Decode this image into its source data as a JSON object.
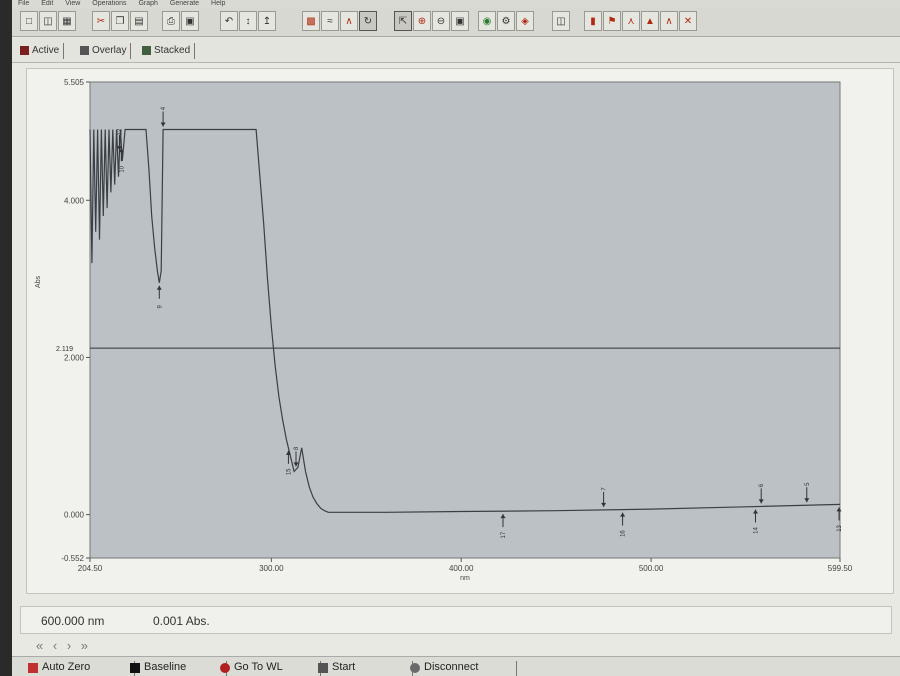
{
  "menu": [
    "File",
    "Edit",
    "View",
    "Operations",
    "Graph",
    "Generate",
    "Help"
  ],
  "tabs": [
    {
      "label": "Active"
    },
    {
      "label": "Overlay"
    },
    {
      "label": "Stacked"
    }
  ],
  "status": {
    "wavelength": "600.000 nm",
    "absorbance": "0.001 Abs."
  },
  "nav_arrows": [
    "«",
    "‹",
    "›",
    "»"
  ],
  "bottom_buttons": [
    {
      "label": "Auto Zero",
      "icon": "auto-zero-icon"
    },
    {
      "label": "Baseline",
      "icon": "baseline-icon"
    },
    {
      "label": "Go To WL",
      "icon": "goto-wl-icon"
    },
    {
      "label": "Start",
      "icon": "start-icon"
    },
    {
      "label": "Disconnect",
      "icon": "disconnect-icon"
    }
  ],
  "colors": {
    "plot_background": "#bcc1c6",
    "trace": "#3a3f44",
    "cursor_line": "#2e3236"
  },
  "chart_data": {
    "type": "line",
    "xlabel": "nm",
    "ylabel": "Abs",
    "xlim": [
      204.5,
      599.5
    ],
    "ylim": [
      -0.552,
      5.505
    ],
    "x_ticks": [
      {
        "value": 204.5,
        "label": "204.50"
      },
      {
        "value": 300,
        "label": "300.00"
      },
      {
        "value": 400,
        "label": "400.00"
      },
      {
        "value": 500,
        "label": "500.00"
      },
      {
        "value": 599.5,
        "label": "599.50"
      }
    ],
    "y_ticks": [
      {
        "value": 5.505,
        "label": "5.505"
      },
      {
        "value": 4.0,
        "label": "4.000"
      },
      {
        "value": 2.0,
        "label": "2.000"
      },
      {
        "value": 0.0,
        "label": "0.000"
      },
      {
        "value": -0.552,
        "label": "-0.552"
      }
    ],
    "cursor": {
      "value": 2.119,
      "label": "2.119"
    },
    "series": [
      {
        "x": [
          204.5,
          205.5,
          206.5,
          207.5,
          208.5,
          209.5,
          210.5,
          211.5,
          212.5,
          213.5,
          214.5,
          215.5,
          216.5,
          217.5,
          218.5,
          219.5,
          220.5,
          221.5,
          223,
          225,
          228,
          230,
          232,
          234,
          235.5,
          237,
          238.5,
          240,
          241,
          242,
          243,
          250,
          260,
          270,
          280,
          292,
          294,
          296,
          298,
          300,
          302,
          304,
          306,
          308,
          310,
          312,
          314,
          316,
          318,
          320,
          322,
          324,
          326,
          328,
          330,
          332,
          335,
          340,
          360,
          400,
          450,
          500,
          550,
          599.5
        ],
        "y": [
          4.9,
          3.2,
          4.9,
          3.6,
          4.9,
          3.5,
          4.9,
          3.8,
          4.9,
          3.9,
          4.9,
          4.1,
          4.9,
          4.2,
          4.9,
          4.3,
          4.9,
          4.5,
          4.9,
          4.9,
          4.9,
          4.9,
          4.9,
          4.9,
          4.4,
          3.8,
          3.4,
          3.1,
          2.95,
          3.1,
          4.9,
          4.9,
          4.9,
          4.9,
          4.9,
          4.9,
          4.3,
          3.7,
          3.0,
          2.4,
          1.9,
          1.5,
          1.2,
          0.95,
          0.75,
          0.55,
          0.6,
          0.85,
          0.55,
          0.35,
          0.22,
          0.14,
          0.08,
          0.05,
          0.03,
          0.03,
          0.03,
          0.03,
          0.03,
          0.04,
          0.05,
          0.07,
          0.1,
          0.13
        ]
      }
    ],
    "peak_markers": [
      {
        "x": 220,
        "label": "12"
      },
      {
        "x": 243,
        "label": "4"
      },
      {
        "x": 313,
        "label": "8"
      },
      {
        "x": 475,
        "label": "7"
      },
      {
        "x": 558,
        "label": "6"
      },
      {
        "x": 582,
        "label": "5"
      }
    ],
    "valley_markers": [
      {
        "x": 221,
        "label": "10"
      },
      {
        "x": 241,
        "label": "9"
      },
      {
        "x": 309,
        "label": "15"
      },
      {
        "x": 422,
        "label": "17"
      },
      {
        "x": 485,
        "label": "16"
      },
      {
        "x": 555,
        "label": "14"
      },
      {
        "x": 599,
        "label": "13"
      }
    ]
  }
}
